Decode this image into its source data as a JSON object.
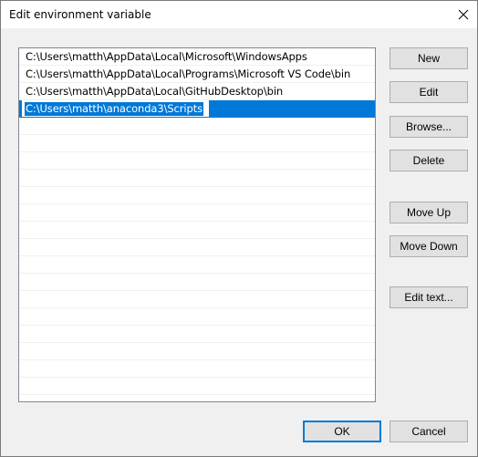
{
  "window": {
    "title": "Edit environment variable"
  },
  "paths": [
    "C:\\Users\\matth\\AppData\\Local\\Microsoft\\WindowsApps",
    "C:\\Users\\matth\\AppData\\Local\\Programs\\Microsoft VS Code\\bin",
    "C:\\Users\\matth\\AppData\\Local\\GitHubDesktop\\bin"
  ],
  "editing": {
    "value": "C:\\Users\\matth\\anaconda3\\Scripts"
  },
  "buttons": {
    "new": "New",
    "edit": "Edit",
    "browse": "Browse...",
    "delete": "Delete",
    "move_up": "Move Up",
    "move_down": "Move Down",
    "edit_text": "Edit text...",
    "ok": "OK",
    "cancel": "Cancel"
  },
  "icons": {
    "close": "close-icon"
  },
  "colors": {
    "selection": "#0078d7",
    "focus_border": "#0078d7"
  }
}
